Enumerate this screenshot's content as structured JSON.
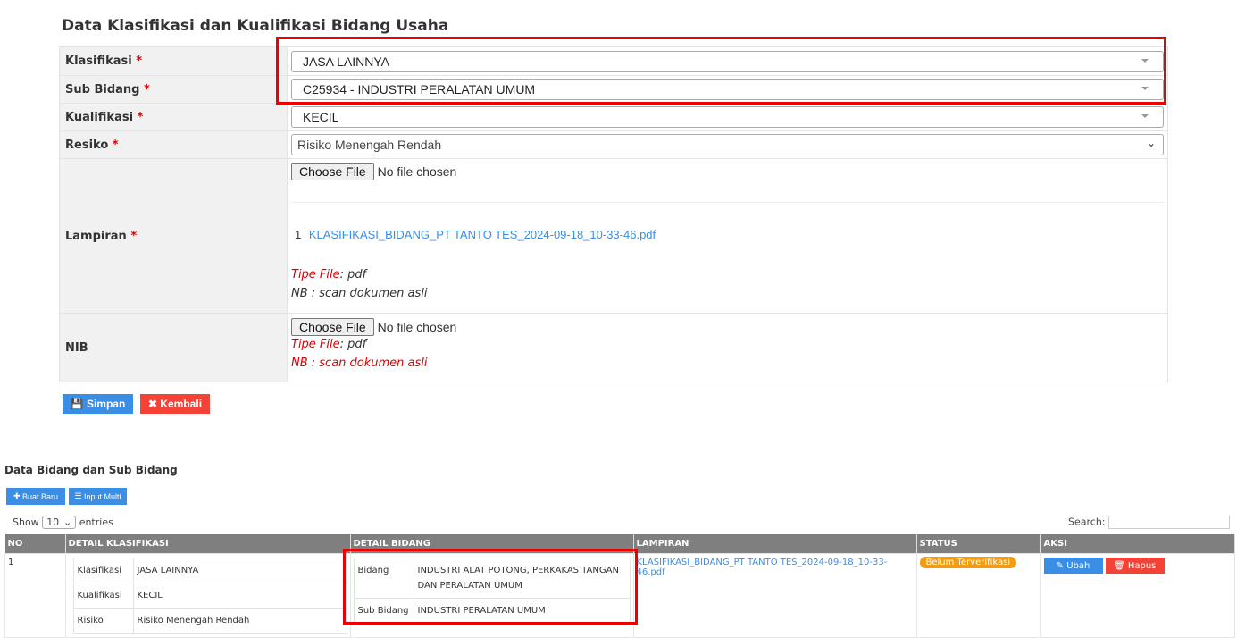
{
  "form": {
    "title": "Data Klasifikasi dan Kualifikasi Bidang Usaha",
    "klasifikasi_label": "Klasifikasi",
    "klasifikasi_value": "JASA LAINNYA",
    "sub_bidang_label": "Sub Bidang",
    "sub_bidang_value": "C25934 - INDUSTRI PERALATAN UMUM",
    "kualifikasi_label": "Kualifikasi",
    "kualifikasi_value": "KECIL",
    "resiko_label": "Resiko",
    "resiko_value": "Risiko Menengah Rendah",
    "lampiran_label": "Lampiran",
    "choose_file": "Choose File",
    "no_file": "No file chosen",
    "file_index": "1",
    "file_link": "KLASIFIKASI_BIDANG_PT TANTO TES_2024-09-18_10-33-46.pdf",
    "tipe_file_label": "Tipe File",
    "tipe_file_value": ": pdf",
    "nb_note": "NB : scan dokumen asli",
    "nib_label": "NIB",
    "required_mark": "*",
    "save_button": "Simpan",
    "back_button": "Kembali"
  },
  "list": {
    "title": "Data Bidang dan Sub Bidang",
    "new_button": "Buat Baru",
    "multi_button": "Input Multi",
    "show_label": "Show",
    "page_size": "10",
    "entries_label": "entries",
    "search_label": "Search:",
    "columns": [
      "NO",
      "DETAIL KLASIFIKASI",
      "DETAIL BIDANG",
      "LAMPIRAN",
      "STATUS",
      "AKSI"
    ],
    "rows": [
      {
        "no": "1",
        "klasifikasi_label": "Klasifikasi",
        "klasifikasi": "JASA LAINNYA",
        "kualifikasi_label": "Kualifikasi",
        "kualifikasi": "KECIL",
        "risiko_label": "Risiko",
        "risiko": "Risiko Menengah Rendah",
        "bidang_label": "Bidang",
        "bidang": "INDUSTRI ALAT POTONG, PERKAKAS TANGAN DAN PERALATAN UMUM",
        "sub_bidang_label": "Sub Bidang",
        "sub_bidang": "INDUSTRI PERALATAN UMUM",
        "lampiran": "KLASIFIKASI_BIDANG_PT TANTO TES_2024-09-18_10-33-46.pdf",
        "status": "Belum Terverifikasi",
        "edit": "Ubah",
        "delete": "Hapus"
      }
    ]
  },
  "colors": {
    "primary": "#3a8ee6",
    "danger": "#f44336",
    "warning": "#f39c12",
    "highlight": "#e00000"
  }
}
